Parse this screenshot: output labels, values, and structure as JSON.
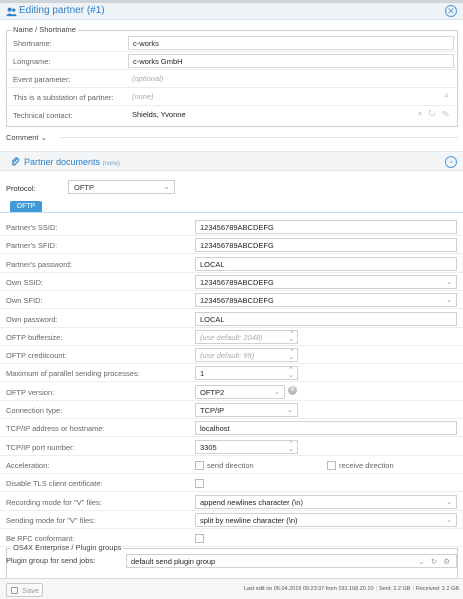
{
  "window": {
    "title": "Editing partner (#1)",
    "close_icon": "close-circle-icon",
    "title_icon": "users-icon"
  },
  "name_section": {
    "legend": "Name / Shortname",
    "rows": [
      {
        "label": "Shortname:",
        "value": "c-works",
        "placeholder": false
      },
      {
        "label": "Longname:",
        "value": "c-works GmbH",
        "placeholder": false
      },
      {
        "label": "Event parameter:",
        "value": "(optional)",
        "placeholder": true
      },
      {
        "label": "This is a substation of partner:",
        "value": "(none)",
        "placeholder": true
      },
      {
        "label": "Technical contact:",
        "value": "Shields, Yvonne",
        "placeholder": false
      }
    ]
  },
  "comment": {
    "label": "Comment"
  },
  "documents": {
    "title": "Partner documents",
    "count": "(none)"
  },
  "protocol": {
    "label": "Protocol:",
    "value": "OFTP",
    "tab": "OFTP"
  },
  "oftp": {
    "rows": [
      {
        "label": "Partner's SSID:",
        "value": "123456789ABCDEFG",
        "type": "text"
      },
      {
        "label": "Partner's SFID:",
        "value": "123456789ABCDEFG",
        "type": "text"
      },
      {
        "label": "Partner's password:",
        "value": "LOCAL",
        "type": "text"
      },
      {
        "label": "Own SSID:",
        "value": "123456789ABCDEFG",
        "type": "select"
      },
      {
        "label": "Own SFID:",
        "value": "123456789ABCDEFG",
        "type": "select"
      },
      {
        "label": "Own password:",
        "value": "LOCAL",
        "type": "text"
      },
      {
        "label": "OFTP buffersize:",
        "value": "(use default: 2048)",
        "type": "spin-ph"
      },
      {
        "label": "OFTP creditcount:",
        "value": "(use default: 99)",
        "type": "spin-ph"
      },
      {
        "label": "Maximum of parallel sending processes:",
        "value": "1",
        "type": "spin"
      },
      {
        "label": "OFTP version:",
        "value": "OFTP2",
        "type": "select-gear"
      },
      {
        "label": "Connection type:",
        "value": "TCP/IP",
        "type": "select-short"
      },
      {
        "label": "TCP/IP address or hostname:",
        "value": "localhost",
        "type": "text"
      },
      {
        "label": "TCP/IP port number:",
        "value": "3305",
        "type": "spin"
      },
      {
        "label": "Acceleration:",
        "type": "checks",
        "options": [
          "send direction",
          "receive direction"
        ]
      },
      {
        "label": "Disable TLS client certificate:",
        "type": "check"
      },
      {
        "label": "Recording mode for \"V\" files:",
        "value": "append newlines character (\\n)",
        "type": "select"
      },
      {
        "label": "Sending mode for \"V\" files:",
        "value": "split by newline character (\\n)",
        "type": "select"
      },
      {
        "label": "Be RFC conformant:",
        "type": "check"
      }
    ]
  },
  "osx": {
    "legend": "OS4X Enterprise / Plugin groups",
    "label": "Plugin group for send jobs:",
    "value": "default send plugin group"
  },
  "footer": {
    "save_label": "Save",
    "last_edit": "Last edit on 05.04.2019 09:23:37 from 192.168.20.10",
    "sent": "Sent: 2.2 GB",
    "received": "Received: 2.2 GB"
  },
  "colors": {
    "accent": "#2f7fc3",
    "tab": "#3f9ad7"
  }
}
